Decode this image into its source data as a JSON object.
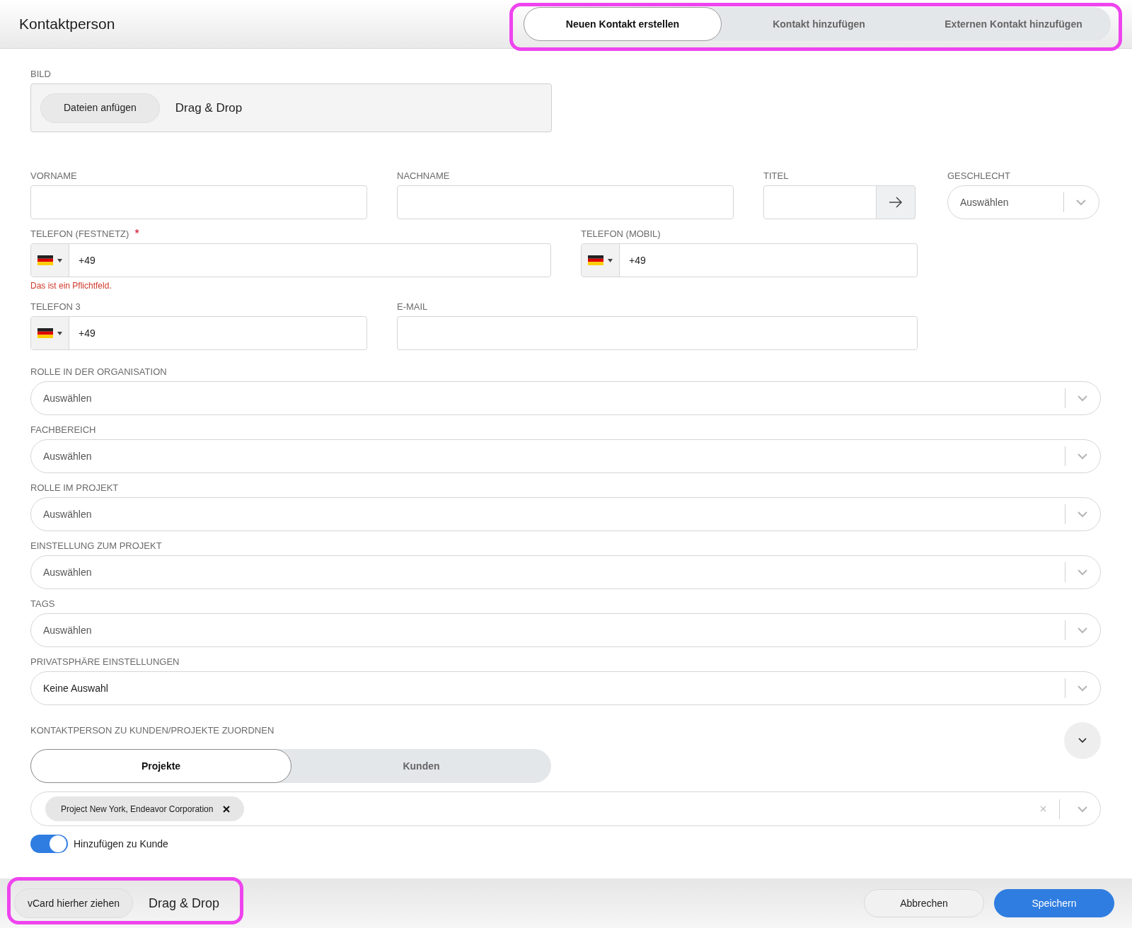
{
  "header": {
    "title": "Kontaktperson",
    "tabs": [
      {
        "label": "Neuen Kontakt erstellen",
        "selected": true
      },
      {
        "label": "Kontakt hinzufügen",
        "selected": false
      },
      {
        "label": "Externen Kontakt hinzufügen",
        "selected": false
      }
    ]
  },
  "image_field": {
    "label": "BILD",
    "button": "Dateien anfügen",
    "hint": "Drag & Drop"
  },
  "rows": [
    [
      {
        "kind": "text",
        "label": "VORNAME"
      },
      {
        "kind": "text",
        "label": "NACHNAME"
      },
      {
        "kind": "title",
        "label": "TITEL"
      },
      {
        "kind": "select",
        "label": "GESCHLECHT",
        "placeholder": "Auswählen"
      }
    ],
    [
      {
        "kind": "phone",
        "label": "TELEFON (FESTNETZ)",
        "required_mark": "*",
        "value": "+49",
        "error": "Das ist ein Pflichtfeld."
      },
      {
        "kind": "phone",
        "label": "TELEFON (MOBIL)",
        "value": "+49"
      }
    ],
    [
      {
        "kind": "phone",
        "label": "TELEFON 3",
        "value": "+49"
      },
      {
        "kind": "text",
        "label": "E-MAIL"
      }
    ]
  ],
  "selects": [
    {
      "label": "ROLLE IN DER ORGANISATION",
      "placeholder": "Auswählen"
    },
    {
      "label": "FACHBEREICH",
      "placeholder": "Auswählen"
    },
    {
      "label": "ROLLE IM PROJEKT",
      "placeholder": "Auswählen"
    },
    {
      "label": "EINSTELLUNG ZUM PROJEKT",
      "placeholder": "Auswählen"
    },
    {
      "label": "TAGS",
      "placeholder": "Auswählen"
    },
    {
      "label": "PRIVATSPHÄRE EINSTELLUNGEN",
      "value": "Keine Auswahl"
    }
  ],
  "assign": {
    "title": "KONTAKTPERSON ZU KUNDEN/PROJEKTE ZUORDNEN",
    "expanded": true,
    "tabs": [
      {
        "label": "Projekte",
        "selected": true
      },
      {
        "label": "Kunden",
        "selected": false
      }
    ],
    "chips": [
      "Project New York, Endeavor Corporation"
    ],
    "toggle": {
      "label": "Hinzufügen zu Kunde",
      "on": true
    }
  },
  "footer": {
    "vcard_button": "vCard hierher ziehen",
    "hint": "Drag & Drop",
    "buttons": [
      {
        "label": "Abbrechen",
        "kind": "secondary"
      },
      {
        "label": "Speichern",
        "kind": "primary"
      }
    ]
  }
}
